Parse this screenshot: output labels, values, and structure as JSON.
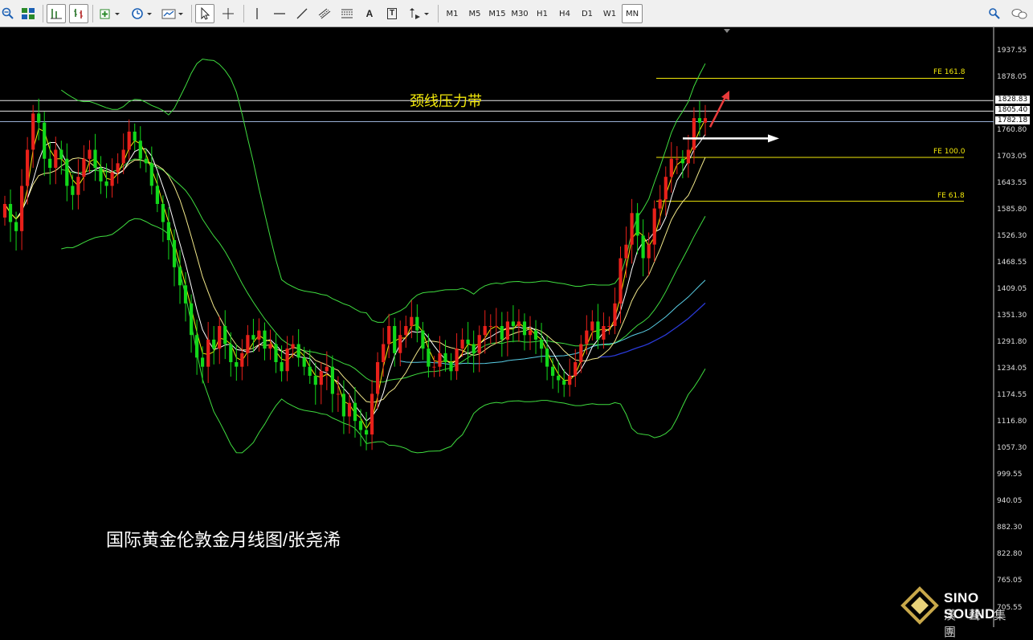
{
  "toolbar": {
    "timeframes": [
      "M1",
      "M5",
      "M15",
      "M30",
      "H1",
      "H4",
      "D1",
      "W1",
      "MN"
    ],
    "active_timeframe": "MN",
    "tools": [
      "zoom-out-icon",
      "tile-windows-icon",
      "line-chart-icon",
      "bar-chart-icon",
      "new-order-icon",
      "clock-icon",
      "template-icon",
      "cursor-icon",
      "crosshair-icon",
      "vertical-line-icon",
      "horizontal-line-icon",
      "trend-line-icon",
      "equidistant-channel-icon",
      "fibonacci-icon",
      "text-icon",
      "text-label-icon",
      "arrow-tools-icon"
    ],
    "text_tool": "A",
    "label_tool": "T"
  },
  "price_axis": {
    "labels": [
      "1937.55",
      "1878.05",
      "1760.80",
      "1703.05",
      "1643.55",
      "1585.80",
      "1526.30",
      "1468.55",
      "1409.05",
      "1351.30",
      "1291.80",
      "1234.05",
      "1174.55",
      "1116.80",
      "1057.30",
      "999.55",
      "940.05",
      "882.30",
      "822.80",
      "765.05"
    ],
    "boxed": [
      "1828.83",
      "1805.40",
      "1782.18"
    ],
    "bottom_partial": "705.55"
  },
  "fibonacci": {
    "levels": [
      {
        "label": "FE 161.8",
        "price": 1878.05
      },
      {
        "label": "FE 100.0",
        "price": 1703.05
      },
      {
        "label": "FE 61.8",
        "price": 1606.0
      }
    ]
  },
  "lines": {
    "resistance_prices": [
      1828.83,
      1805.4,
      1782.18
    ]
  },
  "annotation": "颈线压力带",
  "caption": "国际黄金伦敦金月线图/张尧浠",
  "brand": {
    "name": "SINO SOUND",
    "cn": "漢 聲 集 團"
  },
  "chart_data": {
    "type": "candlestick",
    "title": "国际黄金伦敦金月线图/张尧浠",
    "ylim": [
      705.55,
      1950
    ],
    "series_count": 125,
    "candles_close": [
      1600,
      1560,
      1540,
      1640,
      1720,
      1800,
      1780,
      1700,
      1680,
      1720,
      1700,
      1640,
      1620,
      1660,
      1700,
      1720,
      1680,
      1650,
      1640,
      1670,
      1690,
      1720,
      1760,
      1740,
      1700,
      1690,
      1640,
      1600,
      1560,
      1520,
      1460,
      1420,
      1380,
      1310,
      1260,
      1240,
      1300,
      1280,
      1330,
      1290,
      1250,
      1240,
      1270,
      1310,
      1300,
      1320,
      1280,
      1290,
      1250,
      1230,
      1280,
      1290,
      1260,
      1240,
      1220,
      1200,
      1230,
      1240,
      1180,
      1180,
      1130,
      1160,
      1120,
      1100,
      1090,
      1180,
      1250,
      1290,
      1330,
      1270,
      1310,
      1330,
      1350,
      1320,
      1280,
      1240,
      1240,
      1270,
      1250,
      1230,
      1280,
      1300,
      1290,
      1270,
      1310,
      1330,
      1330,
      1330,
      1300,
      1340,
      1330,
      1340,
      1310,
      1320,
      1300,
      1280,
      1240,
      1220,
      1210,
      1200,
      1220,
      1250,
      1290,
      1320,
      1340,
      1300,
      1330,
      1330,
      1380,
      1480,
      1510,
      1580,
      1530,
      1480,
      1510,
      1590,
      1610,
      1660,
      1700,
      1700,
      1690,
      1720,
      1790,
      1780,
      1790
    ]
  }
}
